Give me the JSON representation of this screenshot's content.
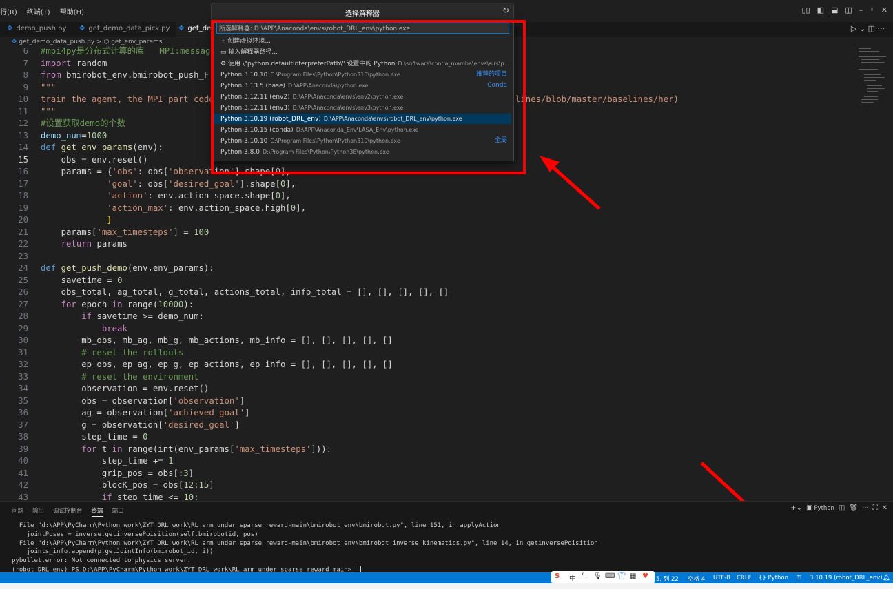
{
  "titlebar": {
    "menu": [
      "行(R)",
      "终端(T)",
      "帮助(H)"
    ],
    "command_title": "选择解释器",
    "refresh_icon": "refresh-icon",
    "window_controls": [
      "layout-icon",
      "panel-left-icon",
      "panel-bottom-icon",
      "panel-right-icon",
      "minimize-icon",
      "maximize-icon",
      "close-icon"
    ]
  },
  "tabs": [
    {
      "label": "demo_push.py"
    },
    {
      "label": "get_demo_data_pick.py"
    },
    {
      "label": "get_dem"
    }
  ],
  "breadcrumb": {
    "file": "get_demo_data_push.py",
    "symbol": "get_env_params"
  },
  "picker": {
    "selected_label": "所选解释器: D:\\APP\\Anaconda\\envs\\robot_DRL_env\\python.exe",
    "actions": [
      "+ 创建虚拟环境...",
      "输入解释器路径...",
      "使用 \\\"python.defaultInterpreterPath\\\" 设置中的 Python"
    ],
    "default_path_hint": "D:\\software\\conda_mamba\\envs\\airs\\p...",
    "items": [
      {
        "name": "Python 3.10.10",
        "path": "C:\\Program Files\\Python\\Python310\\python.exe",
        "tag": "推荐的项目"
      },
      {
        "name": "Python 3.13.5 (base)",
        "path": "D:\\APP\\Anaconda\\python.exe",
        "tag": "Conda"
      },
      {
        "name": "Python 3.12.11 (env2)",
        "path": "D:\\APP\\Anaconda\\envs\\env2\\python.exe",
        "tag": ""
      },
      {
        "name": "Python 3.12.11 (env3)",
        "path": "D:\\APP\\Anaconda\\envs\\env3\\python.exe",
        "tag": ""
      },
      {
        "name": "Python 3.10.19 (robot_DRL_env)",
        "path": "D:\\APP\\Anaconda\\envs\\robot_DRL_env\\python.exe",
        "tag": ""
      },
      {
        "name": "Python 3.10.15 (conda)",
        "path": "D:\\APP\\Anaconda_Env\\LASA_Env\\python.exe",
        "tag": ""
      },
      {
        "name": "Python 3.10.10",
        "path": "C:\\Program Files\\Python\\Python310\\python.exe",
        "tag": "全局"
      },
      {
        "name": "Python 3.8.0",
        "path": "D:\\Program Files\\Python\\Python38\\python.exe",
        "tag": ""
      }
    ]
  },
  "code": {
    "line_numbers": [
      "6",
      "7",
      "8",
      "9",
      "10",
      "11",
      "12",
      "13",
      "14",
      "15",
      "16",
      "17",
      "18",
      "19",
      "20",
      "21",
      "22",
      "23",
      "24",
      "25",
      "26",
      "27",
      "28",
      "29",
      "30",
      "31",
      "32",
      "33",
      "34",
      "35",
      "36",
      "37",
      "38",
      "39",
      "40",
      "41",
      "42",
      "43"
    ],
    "l6": "#mpi4py是分布式计算的库   MPI:messag",
    "l7a": "import",
    "l7b": " random",
    "l8a": "from",
    "l8b": " bmirobot_env.bmirobot_push_F",
    "l9": "\"\"\"",
    "l10a": "train the agent, the MPI part code",
    "l10b": "lines/blob/master/baselines/her)",
    "l11": "\"\"\"",
    "l12": "#设置获取demo的个数",
    "l13a": "demo_num",
    "l13b": "=",
    "l13c": "1000",
    "l14a": "def",
    "l14b": "get_env_params",
    "l14c": "(env):",
    "l15": "    obs = env.reset()",
    "l16a": "    params = {",
    "l16b": "'obs'",
    "l16c": ": obs[",
    "l16d": "'observat",
    "l16e": "ion'].shape[0],",
    "l17a": "             ",
    "l17b": "'goal'",
    "l17c": ": obs[",
    "l17d": "'desired_goal'",
    "l17e": "].shape[",
    "l17f": "0",
    "l17g": "],",
    "l18b": "'action'",
    "l18c": ": env.action_space.shape[",
    "l18f": "0",
    "l18g": "],",
    "l19b": "'action_max'",
    "l19c": ": env.action_space.high[",
    "l19f": "0",
    "l19g": "],",
    "l20": "             }",
    "l21a": "    params[",
    "l21b": "'max_timesteps'",
    "l21c": "] = ",
    "l21d": "100",
    "l22a": "    ",
    "l22b": "return",
    "l22c": " params",
    "l24a": "def",
    "l24b": "get_push_demo",
    "l24c": "(env,env_params):",
    "l25a": "    savetime = ",
    "l25b": "0",
    "l26": "    obs_total, ag_total, g_total, actions_total, info_total = [], [], [], [], []",
    "l27a": "    ",
    "l27b": "for",
    "l27c": " epoch ",
    "l27d": "in",
    "l27e": " range(",
    "l27f": "10000",
    "l27g": "):",
    "l28a": "        ",
    "l28b": "if",
    "l28c": " savetime >= demo_num:",
    "l29a": "            ",
    "l29b": "break",
    "l30": "        mb_obs, mb_ag, mb_g, mb_actions, mb_info = [], [], [], [], []",
    "l31": "        # reset the rollouts",
    "l32": "        ep_obs, ep_ag, ep_g, ep_actions, ep_info = [], [], [], [], []",
    "l33": "        # reset the environment",
    "l34": "        observation = env.reset()",
    "l35a": "        obs = observation[",
    "l35b": "'observation'",
    "l35c": "]",
    "l36a": "        ag = observation[",
    "l36b": "'achieved_goal'",
    "l36c": "]",
    "l37a": "        g = observation[",
    "l37b": "'desired_goal'",
    "l37c": "]",
    "l38a": "        step_time = ",
    "l38b": "0",
    "l39a": "        ",
    "l39b": "for",
    "l39c": " t ",
    "l39d": "in",
    "l39e": " range(int(env_params[",
    "l39f": "'max_timesteps'",
    "l39g": "])):",
    "l40a": "            step_time += ",
    "l40b": "1",
    "l41a": "            grip_pos = obs[:",
    "l41b": "3",
    "l41c": "]",
    "l42a": "            blocK_pos = obs[",
    "l42b": "12",
    "l42c": ":",
    "l42d": "15",
    "l42e": "]",
    "l43a": "            ",
    "l43b": "if",
    "l43c": " step_time <= ",
    "l43d": "10",
    "l43e": ":"
  },
  "panel": {
    "tabs": [
      "问题",
      "输出",
      "调试控制台",
      "终端",
      "端口"
    ],
    "active_tab": "终端",
    "shell_label": "Python",
    "terminal_lines": [
      "  File \"d:\\APP\\PyCharm\\Python_work\\ZYT_DRL_work\\RL_arm_under_sparse_reward-main\\bmirobot_env\\bmirobot.py\", line 151, in applyAction",
      "    jointPoses = inverse.getinversePoisition(self.bmirobotid, pos)",
      "  File \"d:\\APP\\PyCharm\\Python_work\\ZYT_DRL_work\\RL_arm_under_sparse_reward-main\\bmirobot_env\\bmirobot_inverse_kinematics.py\", line 14, in getinversePoisition",
      "    joints_info.append(p.getJointInfo(bmirobot_id, i))",
      "pybullet.error: Not connected to physics server.",
      "(robot_DRL_env) PS D:\\APP\\PyCharm\\Python_work\\ZYT_DRL_work\\RL_arm_under_sparse_reward-main> "
    ]
  },
  "statusbar": {
    "position": "5, 列 22",
    "spaces": "空格 4",
    "encoding": "UTF-8",
    "eol": "CRLF",
    "language": "{} Python",
    "interpreter": "3.10.19 (robot_DRL_env)"
  },
  "ime": {
    "items": [
      "中",
      "°,",
      "mic-icon",
      "keyboard-icon",
      "shirt-icon",
      "grid-icon",
      "emoji-icon"
    ]
  },
  "colors": {
    "annotation_red": "#ff0000",
    "status_blue": "#0078d4",
    "selection_blue": "#04395e"
  }
}
